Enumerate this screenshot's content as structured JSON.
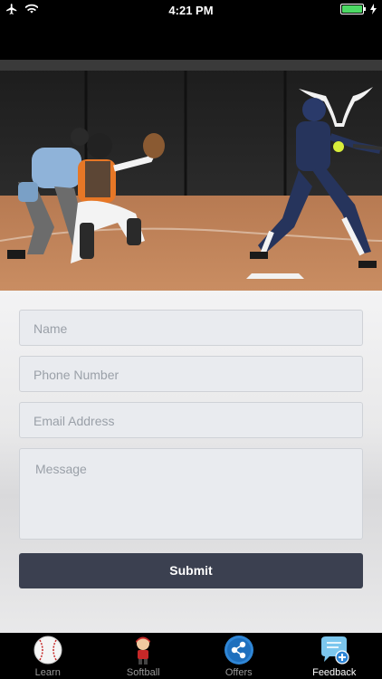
{
  "status_bar": {
    "time": "4:21 PM"
  },
  "form": {
    "name_placeholder": "Name",
    "phone_placeholder": "Phone Number",
    "email_placeholder": "Email Address",
    "message_placeholder": "Message",
    "submit_label": "Submit"
  },
  "tabs": [
    {
      "label": "Learn",
      "icon": "baseball-icon"
    },
    {
      "label": "Softball",
      "icon": "player-icon"
    },
    {
      "label": "Offers",
      "icon": "share-icon"
    },
    {
      "label": "Feedback",
      "icon": "chat-plus-icon",
      "active": true
    }
  ],
  "colors": {
    "submit_bg": "#3b4050",
    "active_tab_label": "#ffffff",
    "inactive_tab_label": "#9a9a9a",
    "battery": "#4cd964"
  }
}
